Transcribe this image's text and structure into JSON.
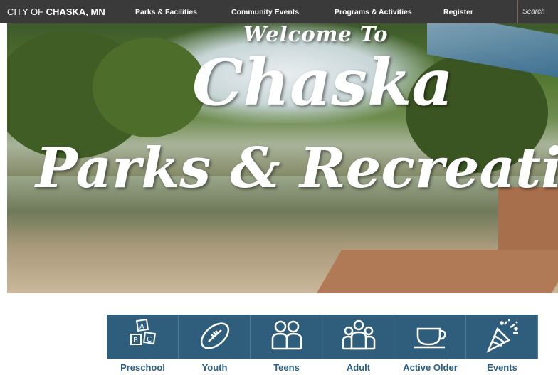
{
  "header": {
    "brand_prefix": "CITY OF",
    "brand_name": "CHASKA, MN",
    "nav": [
      "Parks & Facilities",
      "Community Events",
      "Programs & Activities",
      "Register"
    ],
    "search_placeholder": "Search"
  },
  "hero": {
    "line1": "Welcome To",
    "line2": "Chaska",
    "line3": "Parks & Recreation"
  },
  "categories": [
    {
      "label": "Preschool",
      "icon": "abc-blocks-icon"
    },
    {
      "label": "Youth",
      "icon": "football-icon"
    },
    {
      "label": "Teens",
      "icon": "teens-icon"
    },
    {
      "label": "Adult",
      "icon": "adults-icon"
    },
    {
      "label": "Active Older",
      "icon": "coffee-cup-icon"
    },
    {
      "label": "Events",
      "icon": "party-popper-icon"
    }
  ],
  "colors": {
    "topbar": "#3a3a3a",
    "tile": "#2f5d7c",
    "label": "#2a5e86"
  }
}
